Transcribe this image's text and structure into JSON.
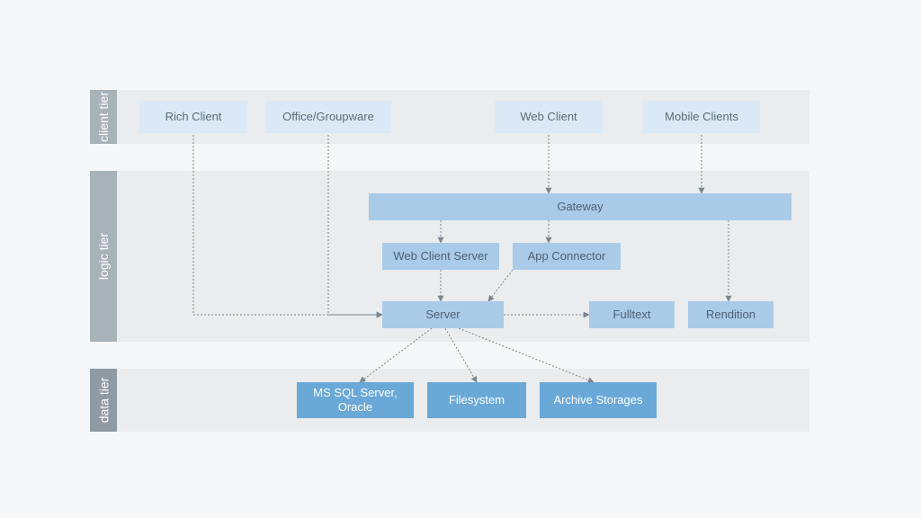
{
  "tiers": {
    "client": "client tier",
    "logic": "logic tier",
    "data": "data tier"
  },
  "nodes": {
    "rich_client": "Rich Client",
    "office_groupware": "Office/Groupware",
    "web_client": "Web Client",
    "mobile_clients": "Mobile Clients",
    "gateway": "Gateway",
    "web_client_server": "Web Client Server",
    "app_connector": "App Connector",
    "server": "Server",
    "fulltext": "Fulltext",
    "rendition": "Rendition",
    "db": "MS SQL Server, Oracle",
    "filesystem": "Filesystem",
    "archive": "Archive Storages"
  },
  "chart_data": {
    "type": "diagram",
    "title": "",
    "tiers": [
      {
        "id": "client",
        "label": "client tier",
        "nodes": [
          "rich_client",
          "office_groupware",
          "web_client",
          "mobile_clients"
        ]
      },
      {
        "id": "logic",
        "label": "logic tier",
        "nodes": [
          "gateway",
          "web_client_server",
          "app_connector",
          "server",
          "fulltext",
          "rendition"
        ]
      },
      {
        "id": "data",
        "label": "data tier",
        "nodes": [
          "db",
          "filesystem",
          "archive"
        ]
      }
    ],
    "nodes": [
      {
        "id": "rich_client",
        "label": "Rich Client"
      },
      {
        "id": "office_groupware",
        "label": "Office/Groupware"
      },
      {
        "id": "web_client",
        "label": "Web Client"
      },
      {
        "id": "mobile_clients",
        "label": "Mobile Clients"
      },
      {
        "id": "gateway",
        "label": "Gateway"
      },
      {
        "id": "web_client_server",
        "label": "Web Client Server"
      },
      {
        "id": "app_connector",
        "label": "App Connector"
      },
      {
        "id": "server",
        "label": "Server"
      },
      {
        "id": "fulltext",
        "label": "Fulltext"
      },
      {
        "id": "rendition",
        "label": "Rendition"
      },
      {
        "id": "db",
        "label": "MS SQL Server, Oracle"
      },
      {
        "id": "filesystem",
        "label": "Filesystem"
      },
      {
        "id": "archive",
        "label": "Archive Storages"
      }
    ],
    "edges": [
      {
        "from": "rich_client",
        "to": "server"
      },
      {
        "from": "office_groupware",
        "to": "server"
      },
      {
        "from": "web_client",
        "to": "gateway"
      },
      {
        "from": "mobile_clients",
        "to": "gateway"
      },
      {
        "from": "gateway",
        "to": "web_client_server"
      },
      {
        "from": "gateway",
        "to": "app_connector"
      },
      {
        "from": "gateway",
        "to": "rendition"
      },
      {
        "from": "web_client_server",
        "to": "server"
      },
      {
        "from": "app_connector",
        "to": "server"
      },
      {
        "from": "server",
        "to": "fulltext"
      },
      {
        "from": "server",
        "to": "db"
      },
      {
        "from": "server",
        "to": "filesystem"
      },
      {
        "from": "server",
        "to": "archive"
      }
    ]
  }
}
